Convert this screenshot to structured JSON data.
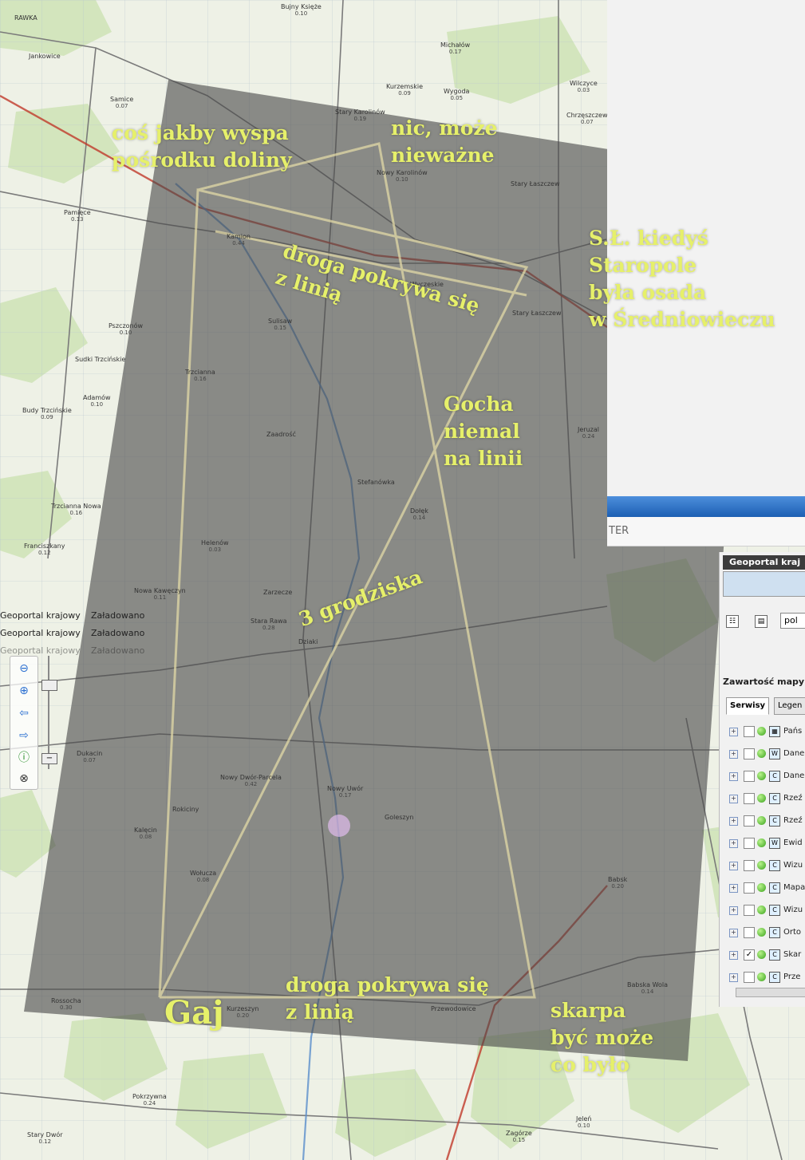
{
  "annotations": {
    "island": "coś jakby wyspa\npośrodku doliny",
    "nothing": "nic, może\nnieważne",
    "staropole": "S.Ł. kiedyś\nStaropole\nbyła osada\nw Średniowieczu",
    "road_top": "droga pokrywa się\nz linią",
    "gocha": "Gocha\nniemal\nna linii",
    "grodziska": "3 grodziska",
    "gaj": "Gaj",
    "road_bottom": "droga pokrywa się\nz linią",
    "skarpa": "skarpa\nbyć może\nco było"
  },
  "places": [
    {
      "name": "RAWKA",
      "value": ""
    },
    {
      "name": "Bujny Księże",
      "value": "0.10"
    },
    {
      "name": "Michałów",
      "value": "0.17"
    },
    {
      "name": "Jankowice",
      "value": ""
    },
    {
      "name": "Samice",
      "value": "0.07"
    },
    {
      "name": "Kurzemskie",
      "value": "0.09"
    },
    {
      "name": "Wygoda",
      "value": "0.05"
    },
    {
      "name": "Wilczyce",
      "value": "0.03"
    },
    {
      "name": "Stary Karolinów",
      "value": "0.19"
    },
    {
      "name": "Nowy Karolinów",
      "value": "0.10"
    },
    {
      "name": "Chrzęszczew",
      "value": "0.07"
    },
    {
      "name": "Stary Łaszczew",
      "value": ""
    },
    {
      "name": "Pamięce",
      "value": "0.13"
    },
    {
      "name": "Kamion",
      "value": "0.44"
    },
    {
      "name": "Wyczeskie",
      "value": ""
    },
    {
      "name": "Stary Łaszczew",
      "value": ""
    },
    {
      "name": "Sulisaw",
      "value": "0.15"
    },
    {
      "name": "Pszczonów",
      "value": "0.10"
    },
    {
      "name": "Sudki Trzcińskie",
      "value": ""
    },
    {
      "name": "Trzcianna",
      "value": "0.16"
    },
    {
      "name": "Adamów",
      "value": "0.10"
    },
    {
      "name": "Budy Trzcińskie",
      "value": "0.09"
    },
    {
      "name": "Jeruzal",
      "value": "0.24"
    },
    {
      "name": "Zaadrość",
      "value": ""
    },
    {
      "name": "Trzcianna Nowa",
      "value": "0.16"
    },
    {
      "name": "Franciszkany",
      "value": "0.12"
    },
    {
      "name": "Helenów",
      "value": "0.03"
    },
    {
      "name": "Stefanówka",
      "value": ""
    },
    {
      "name": "Dołęk",
      "value": "0.14"
    },
    {
      "name": "Nowa Kawęczyn",
      "value": "0.11"
    },
    {
      "name": "Stara Rawa",
      "value": "0.28"
    },
    {
      "name": "Zarzecze",
      "value": ""
    },
    {
      "name": "Dziaki",
      "value": ""
    },
    {
      "name": "Dukacin",
      "value": "0.07"
    },
    {
      "name": "Nowy Dwór-Parcela",
      "value": "0.42"
    },
    {
      "name": "Rokiciny",
      "value": ""
    },
    {
      "name": "Nowy Uwór",
      "value": "0.17"
    },
    {
      "name": "Goleszyn",
      "value": ""
    },
    {
      "name": "Kalęcin",
      "value": "0.08"
    },
    {
      "name": "Wołucza",
      "value": "0.08"
    },
    {
      "name": "Babsk",
      "value": "0.20"
    },
    {
      "name": "Rossocha",
      "value": "0.30"
    },
    {
      "name": "Kurzeszyn",
      "value": "0.20"
    },
    {
      "name": "Przewodowice",
      "value": ""
    },
    {
      "name": "Babska Wola",
      "value": "0.14"
    },
    {
      "name": "Pokrzywna",
      "value": "0.24"
    },
    {
      "name": "Jeleń",
      "value": "0.10"
    },
    {
      "name": "Zagórze",
      "value": "0.15"
    },
    {
      "name": "Stary Dwór",
      "value": "0.12"
    }
  ],
  "status_rows": [
    {
      "service": "Geoportal krajowy",
      "state": "Załadowano"
    },
    {
      "service": "Geoportal krajowy",
      "state": "Załadowano"
    },
    {
      "service": "Geoportal krajowy",
      "state": "Załadowano"
    }
  ],
  "panel": {
    "ter": "TER",
    "title": "Geoportal kraj",
    "lang": "pol",
    "section_title": "Zawartość mapy",
    "tabs": [
      "Serwisy",
      "Legen"
    ],
    "layers": [
      {
        "label": "Pańs",
        "checked": false,
        "icon": "map"
      },
      {
        "label": "Dane",
        "checked": false,
        "icon": "wms"
      },
      {
        "label": "Dane",
        "checked": false,
        "icon": "c"
      },
      {
        "label": "Rzeź",
        "checked": false,
        "icon": "c"
      },
      {
        "label": "Rzeź",
        "checked": false,
        "icon": "c"
      },
      {
        "label": "Ewid",
        "checked": false,
        "icon": "wms"
      },
      {
        "label": "Wizu",
        "checked": false,
        "icon": "c"
      },
      {
        "label": "Mapa",
        "checked": false,
        "icon": "c"
      },
      {
        "label": "Wizu",
        "checked": false,
        "icon": "c"
      },
      {
        "label": "Orto",
        "checked": false,
        "icon": "c"
      },
      {
        "label": "Skar",
        "checked": true,
        "icon": "c"
      },
      {
        "label": "Prze",
        "checked": false,
        "icon": "c"
      }
    ]
  },
  "colors": {
    "annotation": "#e6f06a",
    "overlay": "#5a5a5a",
    "line": "#e2d9a6",
    "panel_bar": "#1c5fb3"
  }
}
